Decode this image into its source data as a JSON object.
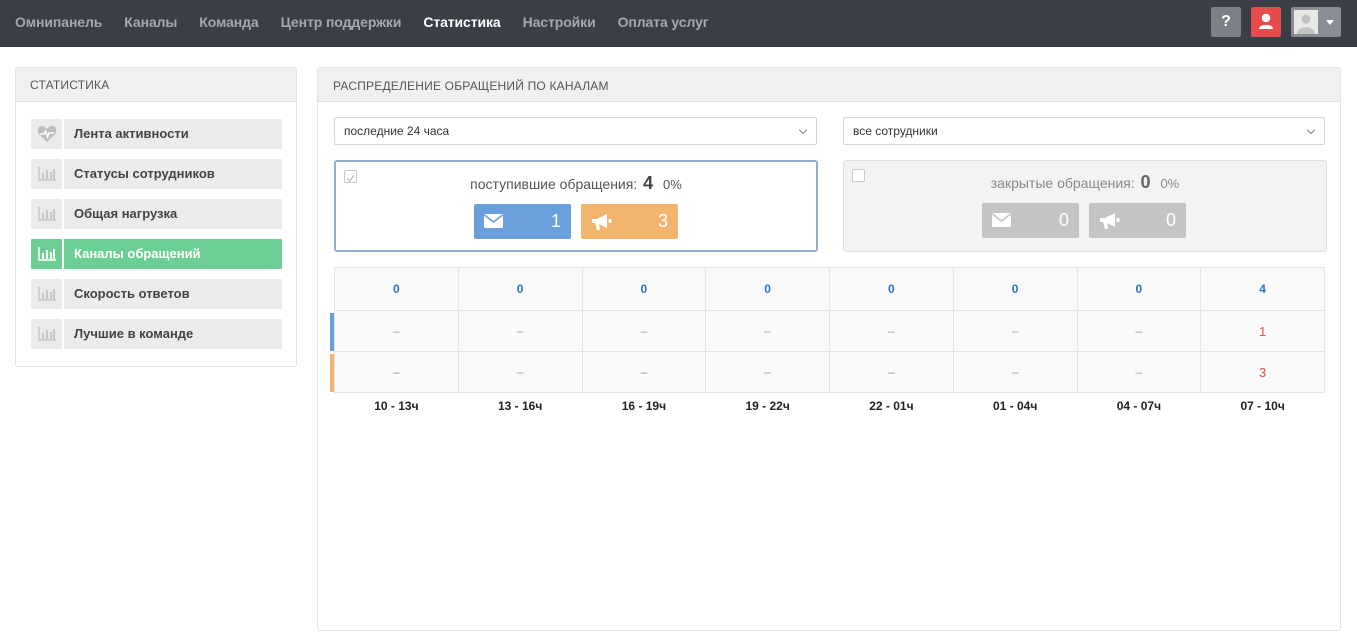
{
  "nav": {
    "items": [
      "Омнипанель",
      "Каналы",
      "Команда",
      "Центр поддержки",
      "Статистика",
      "Настройки",
      "Оплата услуг"
    ],
    "active_index": 4,
    "help_label": "?"
  },
  "sidebar": {
    "title": "СТАТИСТИКА",
    "items": [
      {
        "label": "Лента активности",
        "icon": "heartbeat-icon"
      },
      {
        "label": "Статусы сотрудников",
        "icon": "bar-chart-icon"
      },
      {
        "label": "Общая нагрузка",
        "icon": "bar-chart-icon"
      },
      {
        "label": "Каналы обращений",
        "icon": "bar-chart-icon"
      },
      {
        "label": "Скорость ответов",
        "icon": "bar-chart-icon"
      },
      {
        "label": "Лучшие в команде",
        "icon": "bar-chart-icon"
      }
    ],
    "active_index": 3
  },
  "main": {
    "title": "РАСПРЕДЕЛЕНИЕ ОБРАЩЕНИЙ ПО КАНАЛАМ",
    "period_select": "последние 24 часа",
    "staff_select": "все сотрудники",
    "incoming": {
      "label": "поступившие обращения:",
      "count": "4",
      "percent": "0%",
      "mail": "1",
      "horn": "3"
    },
    "closed": {
      "label": "закрытые обращения:",
      "count": "0",
      "percent": "0%",
      "mail": "0",
      "horn": "0"
    },
    "table": {
      "totals": [
        "0",
        "0",
        "0",
        "0",
        "0",
        "0",
        "0",
        "4"
      ],
      "mail_row": [
        "–",
        "–",
        "–",
        "–",
        "–",
        "–",
        "–",
        "1"
      ],
      "horn_row": [
        "–",
        "–",
        "–",
        "–",
        "–",
        "–",
        "–",
        "3"
      ],
      "intervals": [
        "10 - 13ч",
        "13 - 16ч",
        "16 - 19ч",
        "19 - 22ч",
        "22 - 01ч",
        "01 - 04ч",
        "04 - 07ч",
        "07 - 10ч"
      ]
    }
  },
  "colors": {
    "mail": "#6a9fdc",
    "horn": "#f2b56e",
    "active": "#6cce93",
    "accent_blue": "#2e72c7",
    "accent_red": "#d9534f"
  }
}
